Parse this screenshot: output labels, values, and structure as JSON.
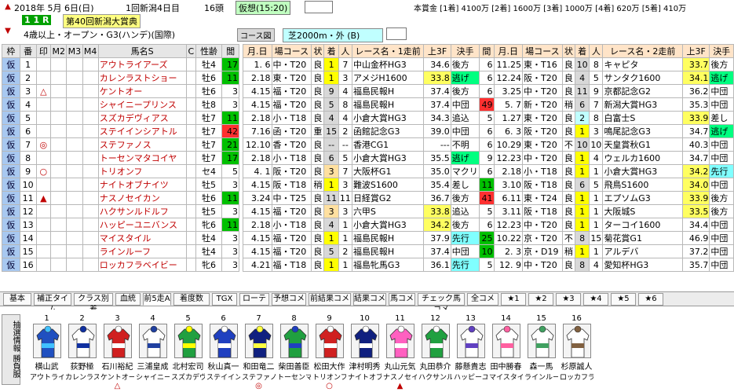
{
  "header": {
    "date": "2018年 5月 6日(日)",
    "meeting": "1回新潟4日目",
    "heads": "16頭",
    "forecast": "仮想(15:20)",
    "race_no": "1 1 R",
    "race_name": "第40回新潟大賞典",
    "conditions": "4歳以上・オープン・G3(ハンデ)(国際)",
    "course_label": "コース図",
    "course": "芝2000m・外 (B)",
    "prize": "本賞金 [1着] 4100万 [2着] 1600万 [3着] 1000万 [4着] 620万 [5着] 410万"
  },
  "columns": {
    "left": [
      "枠",
      "番",
      "印",
      "M2",
      "M3",
      "M4",
      "馬名S",
      "C",
      "性齢",
      "閭"
    ],
    "right": [
      "月.日",
      "場コース",
      "状",
      "着",
      "人",
      "レース名・1走前",
      "上3F",
      "決手",
      "間",
      "月.日",
      "場コース",
      "状",
      "着",
      "人",
      "レース名・2走前",
      "上3F",
      "決手"
    ]
  },
  "rows": [
    {
      "waku": "仮",
      "no": "1",
      "mark": "",
      "name": "アウトライアーズ",
      "sex": "牡4",
      "rest": "17",
      "d1": "1. 6",
      "c1": "中・T20",
      "s1": "良",
      "f1": "1",
      "p1": "7",
      "r1": "中山金杯HG3",
      "t1": "34.6",
      "k1": "後方",
      "i1": "6",
      "d2": "11.25",
      "c2": "東・T16",
      "s2": "良",
      "f2": "10",
      "p2": "8",
      "r2": "キャピタ",
      "t2": "33.7",
      "k2": "後方"
    },
    {
      "waku": "仮",
      "no": "2",
      "mark": "",
      "name": "カレンラストショー",
      "sex": "牡6",
      "rest": "11",
      "d1": "2.18",
      "c1": "東・T20",
      "s1": "良",
      "f1": "1",
      "p1": "3",
      "r1": "アメジH1600",
      "t1": "33.8",
      "k1": "逃げ",
      "i1": "6",
      "d2": "12.24",
      "c2": "阪・T20",
      "s2": "良",
      "f2": "4",
      "p2": "5",
      "r2": "サンタク1600",
      "t2": "34.1",
      "k2": "逃げ"
    },
    {
      "waku": "仮",
      "no": "3",
      "mark": "△",
      "name": "ケントオー",
      "sex": "牡6",
      "rest": "3",
      "d1": "4.15",
      "c1": "福・T20",
      "s1": "良",
      "f1": "9",
      "p1": "4",
      "r1": "福島民報H",
      "t1": "37.4",
      "k1": "後方",
      "i1": "6",
      "d2": "3.25",
      "c2": "中・T20",
      "s2": "良",
      "f2": "11",
      "p2": "9",
      "r2": "京都記念G2",
      "t2": "36.2",
      "k2": "中団"
    },
    {
      "waku": "仮",
      "no": "4",
      "mark": "",
      "name": "シャイニープリンス",
      "sex": "牡8",
      "rest": "3",
      "d1": "4.15",
      "c1": "福・T20",
      "s1": "良",
      "f1": "5",
      "p1": "8",
      "r1": "福島民報H",
      "t1": "37.4",
      "k1": "中団",
      "i1": "49",
      "d2": "5. 7",
      "c2": "新・T20",
      "s2": "稍",
      "f2": "6",
      "p2": "7",
      "r2": "新潟大賞HG3",
      "t2": "35.3",
      "k2": "中団"
    },
    {
      "waku": "仮",
      "no": "5",
      "mark": "",
      "name": "スズカデヴィアス",
      "sex": "牡7",
      "rest": "11",
      "d1": "2.18",
      "c1": "小・T18",
      "s1": "良",
      "f1": "4",
      "p1": "4",
      "r1": "小倉大賞HG3",
      "t1": "34.3",
      "k1": "追込",
      "i1": "5",
      "d2": "1.27",
      "c2": "東・T20",
      "s2": "良",
      "f2": "2",
      "p2": "8",
      "r2": "白富士S",
      "t2": "33.9",
      "k2": "差し"
    },
    {
      "waku": "仮",
      "no": "6",
      "mark": "",
      "name": "ステイインシアトル",
      "sex": "牡7",
      "rest": "42",
      "d1": "7.16",
      "c1": "函・T20",
      "s1": "重",
      "f1": "15",
      "p1": "2",
      "r1": "函館記念G3",
      "t1": "39.0",
      "k1": "中団",
      "i1": "6",
      "d2": "6. 3",
      "c2": "阪・T20",
      "s2": "良",
      "f2": "1",
      "p2": "3",
      "r2": "鳴尾記念G3",
      "t2": "34.7",
      "k2": "逃げ"
    },
    {
      "waku": "仮",
      "no": "7",
      "mark": "◎",
      "name": "ステファノス",
      "sex": "牡7",
      "rest": "21",
      "d1": "12.10",
      "c1": "香・T20",
      "s1": "良",
      "f1": "--",
      "p1": "--",
      "r1": "香港CG1",
      "t1": "---",
      "k1": "不明",
      "i1": "6",
      "d2": "10.29",
      "c2": "東・T20",
      "s2": "不",
      "f2": "10",
      "p2": "10",
      "r2": "天皇賞秋G1",
      "t2": "40.3",
      "k2": "中団"
    },
    {
      "waku": "仮",
      "no": "8",
      "mark": "",
      "name": "トーセンマタコイヤ",
      "sex": "牡7",
      "rest": "17",
      "d1": "2.18",
      "c1": "小・T18",
      "s1": "良",
      "f1": "6",
      "p1": "5",
      "r1": "小倉大賞HG3",
      "t1": "35.5",
      "k1": "逃げ",
      "i1": "9",
      "d2": "12.23",
      "c2": "中・T20",
      "s2": "良",
      "f2": "1",
      "p2": "4",
      "r2": "ウェルカ1600",
      "t2": "34.7",
      "k2": "中団"
    },
    {
      "waku": "仮",
      "no": "9",
      "mark": "○",
      "name": "トリオンフ",
      "sex": "セ4",
      "rest": "5",
      "d1": "4. 1",
      "c1": "阪・T20",
      "s1": "良",
      "f1": "3",
      "p1": "7",
      "r1": "大阪杯G1",
      "t1": "35.0",
      "k1": "マクリ",
      "i1": "6",
      "d2": "2.18",
      "c2": "小・T18",
      "s2": "良",
      "f2": "1",
      "p2": "1",
      "r2": "小倉大賞HG3",
      "t2": "34.2",
      "k2": "先行"
    },
    {
      "waku": "仮",
      "no": "10",
      "mark": "",
      "name": "ナイトオブナイツ",
      "sex": "牡5",
      "rest": "3",
      "d1": "4.15",
      "c1": "阪・T18",
      "s1": "稍",
      "f1": "1",
      "p1": "3",
      "r1": "難波S1600",
      "t1": "35.4",
      "k1": "差し",
      "i1": "11",
      "d2": "3.10",
      "c2": "阪・T18",
      "s2": "良",
      "f2": "6",
      "p2": "5",
      "r2": "飛鳥S1600",
      "t2": "34.0",
      "k2": "中団"
    },
    {
      "waku": "仮",
      "no": "11",
      "mark": "▲",
      "name": "ナスノセイカン",
      "sex": "牡6",
      "rest": "11",
      "d1": "3.24",
      "c1": "中・T25",
      "s1": "良",
      "f1": "11",
      "p1": "11",
      "r1": "日経賞G2",
      "t1": "36.7",
      "k1": "後方",
      "i1": "41",
      "d2": "6.11",
      "c2": "東・T24",
      "s2": "良",
      "f2": "1",
      "p2": "1",
      "r2": "エプソムG3",
      "t2": "33.9",
      "k2": "後方"
    },
    {
      "waku": "仮",
      "no": "12",
      "mark": "",
      "name": "ハクサンルドルフ",
      "sex": "牡5",
      "rest": "3",
      "d1": "4.15",
      "c1": "福・T20",
      "s1": "良",
      "f1": "3",
      "p1": "3",
      "r1": "六甲S",
      "t1": "33.8",
      "k1": "追込",
      "i1": "5",
      "d2": "3.11",
      "c2": "阪・T18",
      "s2": "良",
      "f2": "1",
      "p2": "1",
      "r2": "大阪城S",
      "t2": "33.5",
      "k2": "後方"
    },
    {
      "waku": "仮",
      "no": "13",
      "mark": "",
      "name": "ハッピーユニバンス",
      "sex": "牝6",
      "rest": "11",
      "d1": "2.18",
      "c1": "小・T18",
      "s1": "良",
      "f1": "4",
      "p1": "1",
      "r1": "小倉大賞HG3",
      "t1": "34.2",
      "k1": "後方",
      "i1": "6",
      "d2": "12.23",
      "c2": "中・T20",
      "s2": "良",
      "f2": "1",
      "p2": "1",
      "r2": "ターコイ1600",
      "t2": "34.4",
      "k2": "中団"
    },
    {
      "waku": "仮",
      "no": "14",
      "mark": "",
      "name": "マイスタイル",
      "sex": "牡4",
      "rest": "3",
      "d1": "4.15",
      "c1": "福・T20",
      "s1": "良",
      "f1": "1",
      "p1": "1",
      "r1": "福島民報H",
      "t1": "37.9",
      "k1": "先行",
      "i1": "25",
      "d2": "10.22",
      "c2": "京・T20",
      "s2": "不",
      "f2": "8",
      "p2": "15",
      "r2": "菊花賞G1",
      "t2": "46.9",
      "k2": "中団"
    },
    {
      "waku": "仮",
      "no": "15",
      "mark": "",
      "name": "ラインルーフ",
      "sex": "牡4",
      "rest": "3",
      "d1": "4.15",
      "c1": "福・T20",
      "s1": "良",
      "f1": "5",
      "p1": "2",
      "r1": "福島民報H",
      "t1": "37.4",
      "k1": "中団",
      "i1": "10",
      "d2": "2. 3",
      "c2": "京・D19",
      "s2": "稍",
      "f2": "1",
      "p2": "1",
      "r2": "アルデバ",
      "t2": "37.2",
      "k2": "中団"
    },
    {
      "waku": "仮",
      "no": "16",
      "mark": "",
      "name": "ロッカフラベイビー",
      "sex": "牝6",
      "rest": "3",
      "d1": "4.21",
      "c1": "福・T18",
      "s1": "良",
      "f1": "1",
      "p1": "1",
      "r1": "福島牝馬G3",
      "t1": "36.1",
      "k1": "先行",
      "i1": "5",
      "d2": "12. 9",
      "c2": "中・T20",
      "s2": "良",
      "f2": "8",
      "p2": "4",
      "r2": "愛知杯HG3",
      "t2": "35.7",
      "k2": "中団"
    }
  ],
  "tabs": [
    "基本",
    "補正タイム",
    "クラス別着",
    "血統",
    "前5走A",
    "着度数",
    "TGX",
    "ローテ",
    "予想コメ",
    "前結果コメ",
    "結果コメ",
    "馬コメ",
    "チェック馬コメ",
    "全コメ",
    "★1",
    "★2",
    "★3",
    "★4",
    "★5",
    "★6"
  ],
  "silks_label": "抽選情報 勝負服",
  "silks": [
    {
      "no": "1",
      "jockey": "横山武",
      "horse": "アウトライ",
      "mark": "",
      "colors": [
        "#2050c0",
        "#40c0ff"
      ]
    },
    {
      "no": "2",
      "jockey": "荻野極",
      "horse": "カレンラス",
      "mark": "",
      "colors": [
        "#ffffff",
        "#1030a0"
      ]
    },
    {
      "no": "3",
      "jockey": "石川裕紀",
      "horse": "ケントオー",
      "mark": "△",
      "colors": [
        "#d02020",
        "#ffffff"
      ]
    },
    {
      "no": "4",
      "jockey": "三浦皇成",
      "horse": "シャイニー",
      "mark": "",
      "colors": [
        "#ffffff",
        "#2040a0"
      ]
    },
    {
      "no": "5",
      "jockey": "北村宏司",
      "horse": "スズカデヴ",
      "mark": "",
      "colors": [
        "#20a040",
        "#ffff00"
      ]
    },
    {
      "no": "6",
      "jockey": "秋山真一",
      "horse": "ステイイン",
      "mark": "",
      "colors": [
        "#2040c0",
        "#ffffff"
      ]
    },
    {
      "no": "7",
      "jockey": "和田竜二",
      "horse": "ステファノ",
      "mark": "◎",
      "colors": [
        "#102080",
        "#ffff40"
      ]
    },
    {
      "no": "8",
      "jockey": "柴田善臣",
      "horse": "トーセンマ",
      "mark": "",
      "colors": [
        "#20a040",
        "#2040c0"
      ]
    },
    {
      "no": "9",
      "jockey": "松田大作",
      "horse": "トリオンフ",
      "mark": "○",
      "colors": [
        "#d02020",
        "#ffffff"
      ]
    },
    {
      "no": "10",
      "jockey": "津村明秀",
      "horse": "ナイトオブ",
      "mark": "",
      "colors": [
        "#102080",
        "#ffffff"
      ]
    },
    {
      "no": "11",
      "jockey": "丸山元気",
      "horse": "ナスノセイ",
      "mark": "▲",
      "colors": [
        "#ff60c0",
        "#ffffff"
      ]
    },
    {
      "no": "12",
      "jockey": "丸田恭介",
      "horse": "ハクサンル",
      "mark": "",
      "colors": [
        "#20a040",
        "#ffffff"
      ]
    },
    {
      "no": "13",
      "jockey": "藤懸貴志",
      "horse": "ハッピーユ",
      "mark": "",
      "colors": [
        "#ffffff",
        "#6040c0"
      ]
    },
    {
      "no": "14",
      "jockey": "田中勝春",
      "horse": "マイスタイ",
      "mark": "",
      "colors": [
        "#ffffff",
        "#ff60a0"
      ]
    },
    {
      "no": "15",
      "jockey": "森一馬",
      "horse": "ラインルー",
      "mark": "",
      "colors": [
        "#ffffff",
        "#40a060"
      ]
    },
    {
      "no": "16",
      "jockey": "杉原誠人",
      "horse": "ロッカフラ",
      "mark": "",
      "colors": [
        "#ffffff",
        "#806040"
      ]
    }
  ]
}
